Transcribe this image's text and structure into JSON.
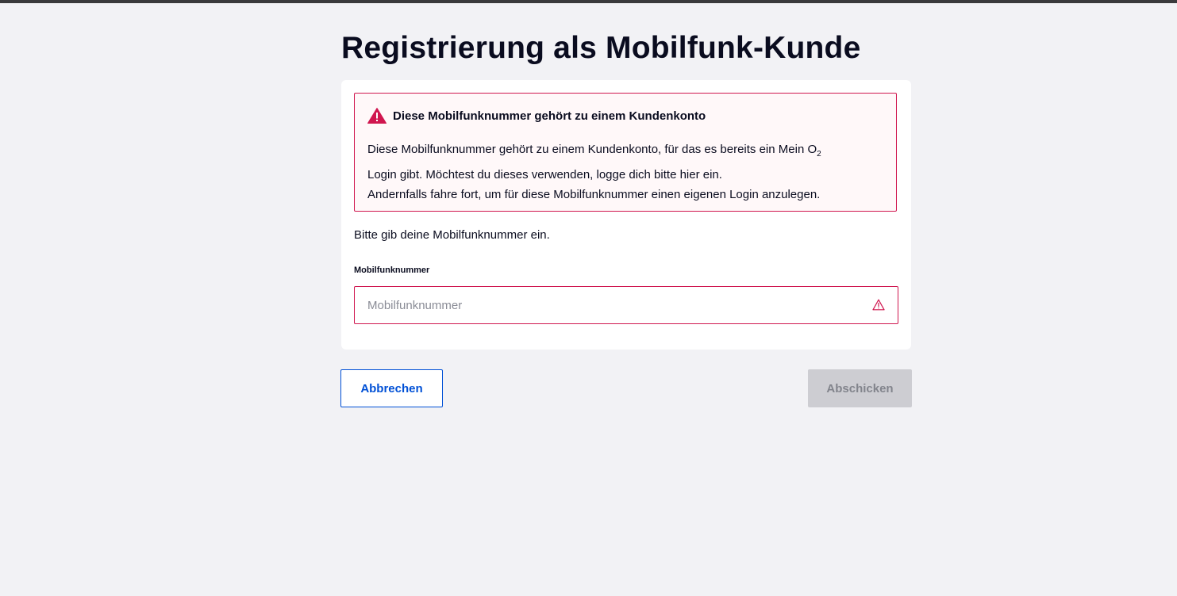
{
  "page": {
    "title": "Registrierung als Mobilfunk-Kunde"
  },
  "alert": {
    "title": "Diese Mobilfunknummer gehört zu einem Kundenkonto",
    "line1": "Diese Mobilfunknummer gehört zu einem Kundenkonto, für das es bereits ein Mein O",
    "line1_subscript": "2",
    "line2": "Login gibt. Möchtest du dieses verwenden, logge dich bitte hier ein.",
    "line3": "Andernfalls fahre fort, um für diese Mobilfunknummer einen eigenen Login anzulegen.",
    "icon": "warning-triangle-icon",
    "color": "#d0164f"
  },
  "form": {
    "intro": "Bitte gib deine Mobilfunknummer ein.",
    "phone_label": "Mobilfunknummer",
    "phone_placeholder": "Mobilfunknummer",
    "phone_value": "",
    "error_icon": "warning-outline-icon"
  },
  "actions": {
    "cancel_label": "Abbrechen",
    "submit_label": "Abschicken"
  },
  "colors": {
    "background": "#f2f2f5",
    "primary": "#0050d6",
    "error": "#d0164f",
    "disabled": "#cdcdd2"
  }
}
